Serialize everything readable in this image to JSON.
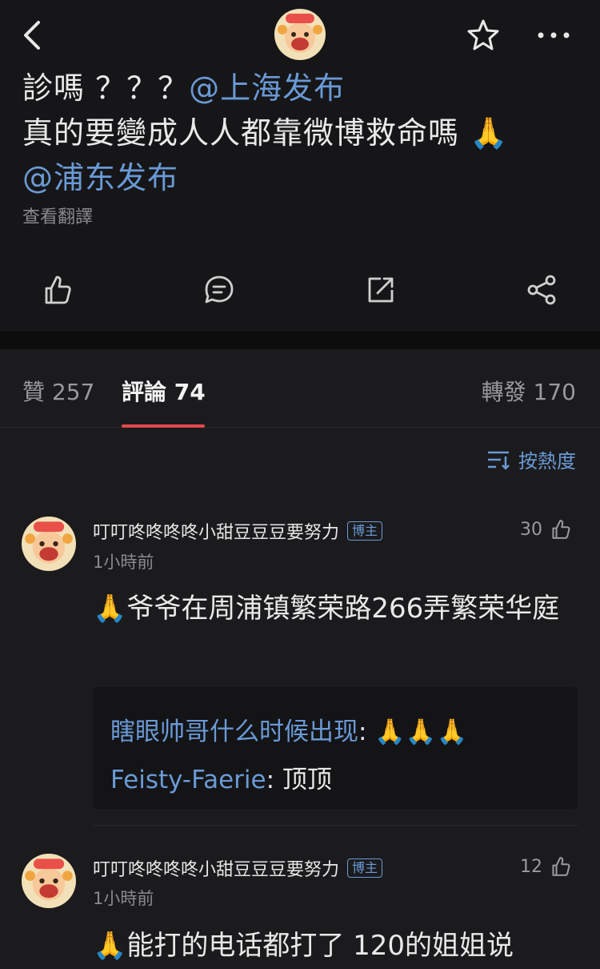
{
  "post": {
    "line1_text": "診嗎 ？？？",
    "line1_mention": "@上海发布",
    "line2_text": " 真的要變成人人都靠微博救命嗎 🙏",
    "line3_mention": "@浦东发布",
    "translate_label": "查看翻譯"
  },
  "tabs": {
    "likes": "贊 257",
    "comments": "評論 74",
    "reposts": "轉發 170"
  },
  "sort_label": "按熱度",
  "comments": [
    {
      "name": "叮叮咚咚咚咚小甜豆豆豆要努力",
      "badge": "博主",
      "time": "1小時前",
      "likes": "30",
      "text": "🙏爷爷在周浦镇繁荣路266弄繁荣华庭",
      "replies": [
        {
          "name": "瞎眼帅哥什么时候出现",
          "text": ": 🙏🙏🙏"
        },
        {
          "name": "Feisty-Faerie",
          "text": ": 顶顶"
        }
      ]
    },
    {
      "name": "叮叮咚咚咚咚小甜豆豆豆要努力",
      "badge": "博主",
      "time": "1小時前",
      "likes": "12",
      "text": "🙏能打的电话都打了 120的姐姐说"
    }
  ],
  "colors": {
    "accent_link": "#6a9ad6",
    "tab_underline": "#e5484d",
    "background": "#1b1b1d"
  },
  "icons": [
    "back-icon",
    "star-icon",
    "more-icon",
    "thumbs-up-icon",
    "comment-icon",
    "repost-icon",
    "share-icon",
    "sort-icon"
  ]
}
